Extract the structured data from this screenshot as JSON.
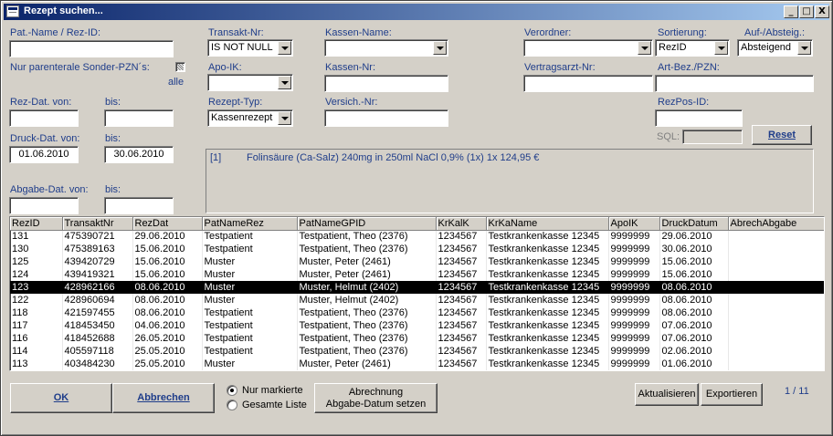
{
  "window": {
    "title": "Rezept suchen..."
  },
  "titlebar_buttons": {
    "minimize": "_",
    "maximize": "□",
    "close": "X"
  },
  "filters": {
    "pat_name_label": "Pat.-Name / Rez-ID:",
    "pat_name_value": "",
    "sonder_label": "Nur parenterale Sonder-PZN´s:",
    "sonder_alle": "alle",
    "rez_dat_von_label": "Rez-Dat. von:",
    "rez_dat_von_value": "",
    "rez_dat_bis_label": "bis:",
    "rez_dat_bis_value": "",
    "druck_dat_von_label": "Druck-Dat. von:",
    "druck_dat_von_value": "01.06.2010",
    "druck_dat_bis_label": "bis:",
    "druck_dat_bis_value": "30.06.2010",
    "abgabe_dat_von_label": "Abgabe-Dat. von:",
    "abgabe_dat_von_value": "",
    "abgabe_dat_bis_label": "bis:",
    "abgabe_dat_bis_value": "",
    "transakt_label": "Transakt-Nr:",
    "transakt_value": "IS NOT NULL",
    "apo_ik_label": "Apo-IK:",
    "apo_ik_value": "",
    "rezept_typ_label": "Rezept-Typ:",
    "rezept_typ_value": "Kassenrezept",
    "kassen_name_label": "Kassen-Name:",
    "kassen_name_value": "",
    "kassen_nr_label": "Kassen-Nr:",
    "kassen_nr_value": "",
    "versich_nr_label": "Versich.-Nr:",
    "versich_nr_value": "",
    "verordner_label": "Verordner:",
    "verordner_value": "",
    "vertragsarzt_label": "Vertragsarzt-Nr:",
    "vertragsarzt_value": "",
    "sortierung_label": "Sortierung:",
    "sortierung_value": "RezID",
    "aufab_label": "Auf-/Absteig.:",
    "aufab_value": "Absteigend",
    "artbez_label": "Art-Bez./PZN:",
    "artbez_value": "",
    "rezpos_label": "RezPos-ID:",
    "rezpos_value": "",
    "sql_label": "SQL:",
    "sql_value": "",
    "reset_label": "Reset"
  },
  "detail": {
    "index": "[1]",
    "text": "Folinsäure (Ca-Salz) 240mg in 250ml NaCl 0,9% (1x)  1x  124,95 €"
  },
  "table": {
    "columns": [
      "RezID",
      "TransaktNr",
      "RezDat",
      "PatNameRez",
      "PatNameGPID",
      "KrKalK",
      "KrKaName",
      "ApoIK",
      "DruckDatum",
      "AbrechAbgabe"
    ],
    "selected_index": 4,
    "rows": [
      [
        "131",
        "475390721",
        "29.06.2010",
        "Testpatient",
        "Testpatient, Theo (2376)",
        "1234567",
        "Testkrankenkasse    12345",
        "9999999",
        "29.06.2010",
        ""
      ],
      [
        "130",
        "475389163",
        "15.06.2010",
        "Testpatient",
        "Testpatient, Theo (2376)",
        "1234567",
        "Testkrankenkasse    12345",
        "9999999",
        "30.06.2010",
        ""
      ],
      [
        "125",
        "439420729",
        "15.06.2010",
        "Muster",
        "Muster, Peter (2461)",
        "1234567",
        "Testkrankenkasse    12345",
        "9999999",
        "15.06.2010",
        ""
      ],
      [
        "124",
        "439419321",
        "15.06.2010",
        "Muster",
        "Muster, Peter (2461)",
        "1234567",
        "Testkrankenkasse    12345",
        "9999999",
        "15.06.2010",
        ""
      ],
      [
        "123",
        "428962166",
        "08.06.2010",
        "Muster",
        "Muster, Helmut (2402)",
        "1234567",
        "Testkrankenkasse    12345",
        "9999999",
        "08.06.2010",
        ""
      ],
      [
        "122",
        "428960694",
        "08.06.2010",
        "Muster",
        "Muster, Helmut (2402)",
        "1234567",
        "Testkrankenkasse    12345",
        "9999999",
        "08.06.2010",
        ""
      ],
      [
        "118",
        "421597455",
        "08.06.2010",
        "Testpatient",
        "Testpatient, Theo (2376)",
        "1234567",
        "Testkrankenkasse    12345",
        "9999999",
        "08.06.2010",
        ""
      ],
      [
        "117",
        "418453450",
        "04.06.2010",
        "Testpatient",
        "Testpatient, Theo (2376)",
        "1234567",
        "Testkrankenkasse    12345",
        "9999999",
        "07.06.2010",
        ""
      ],
      [
        "116",
        "418452688",
        "26.05.2010",
        "Testpatient",
        "Testpatient, Theo (2376)",
        "1234567",
        "Testkrankenkasse    12345",
        "9999999",
        "07.06.2010",
        ""
      ],
      [
        "114",
        "405597118",
        "25.05.2010",
        "Testpatient",
        "Testpatient, Theo (2376)",
        "1234567",
        "Testkrankenkasse    12345",
        "9999999",
        "02.06.2010",
        ""
      ],
      [
        "113",
        "403484230",
        "25.05.2010",
        "Muster",
        "Muster, Peter (2461)",
        "1234567",
        "Testkrankenkasse    12345",
        "9999999",
        "01.06.2010",
        ""
      ]
    ]
  },
  "footer": {
    "ok_label": "OK",
    "abbrechen_label": "Abbrechen",
    "radio_markierte": "Nur markierte",
    "radio_gesamte": "Gesamte Liste",
    "abrechnung_line1": "Abrechnung",
    "abrechnung_line2": "Abgabe-Datum setzen",
    "aktualisieren_label": "Aktualisieren",
    "exportieren_label": "Exportieren",
    "page_indicator": "1 / 11"
  }
}
